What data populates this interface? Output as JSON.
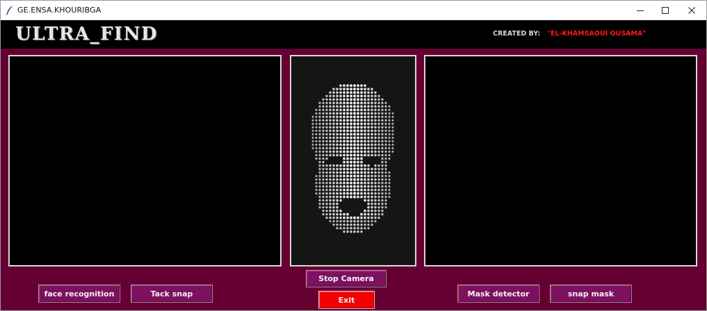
{
  "window": {
    "title": "GE.ENSA.KHOURIBGA",
    "icon": "feather-icon",
    "controls": [
      "minimize-icon",
      "maximize-icon",
      "close-icon"
    ]
  },
  "header": {
    "app_title": "ULTRA_FIND",
    "credit_label": "CREATED BY:   ",
    "credit_name": "\"EL-KHAMSAOUI OUSAMA\""
  },
  "panels": {
    "left": "camera feed (black)",
    "center": "dotted face preview",
    "right": "mask preview (black)"
  },
  "buttons": {
    "face_recognition": "face recognition",
    "tack_snap": "Tack snap",
    "stop_camera": "Stop Camera",
    "exit": "Exit",
    "mask_detector": "Mask detector",
    "snap_mask": "snap mask"
  },
  "colors": {
    "background": "#660033",
    "header": "#000000",
    "button": "#7d1160",
    "exit_button": "#f00000",
    "credit_name": "#ff1a1a"
  }
}
